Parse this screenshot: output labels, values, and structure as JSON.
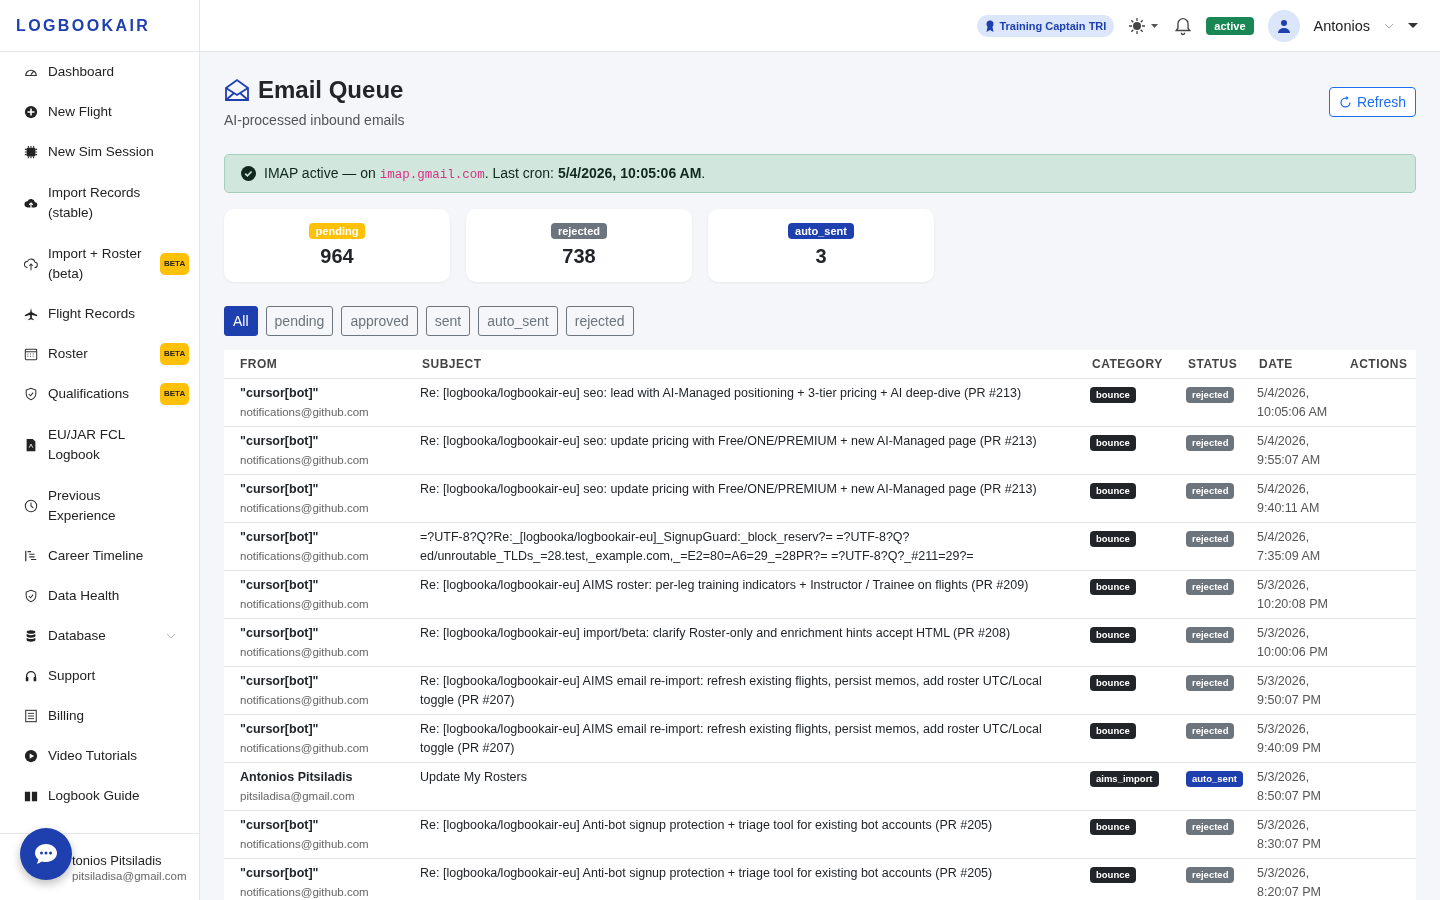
{
  "brand": "LOGBOOKAIR",
  "sidebar": {
    "items": [
      {
        "label": "Dashboard"
      },
      {
        "label": "New Flight"
      },
      {
        "label": "New Sim Session"
      },
      {
        "label": "Import Records (stable)"
      },
      {
        "label": "Import + Roster (beta)",
        "badge": "BETA"
      },
      {
        "label": "Flight Records"
      },
      {
        "label": "Roster",
        "badge": "BETA"
      },
      {
        "label": "Qualifications",
        "badge": "BETA"
      },
      {
        "label": "EU/JAR FCL Logbook"
      },
      {
        "label": "Previous Experience"
      },
      {
        "label": "Career Timeline"
      },
      {
        "label": "Data Health"
      },
      {
        "label": "Database",
        "expanded": false
      },
      {
        "label": "Support"
      },
      {
        "label": "Billing"
      },
      {
        "label": "Video Tutorials"
      },
      {
        "label": "Logbook Guide"
      }
    ],
    "user": {
      "name": "tonios Pitsiladis",
      "email": "pitsiladisa@gmail.com"
    }
  },
  "header": {
    "role": "Training Captain TRI",
    "status": "active",
    "user": "Antonios"
  },
  "page": {
    "title": "Email Queue",
    "subtitle": "AI-processed inbound emails",
    "refresh": "Refresh"
  },
  "alert": {
    "before": "IMAP active — on ",
    "host": "imap.gmail.com",
    "after": ". Last cron: **5/4/2026, 10:05:06 AM**."
  },
  "stats": [
    {
      "label": "pending",
      "value": "964",
      "color": "#ffc107"
    },
    {
      "label": "rejected",
      "value": "738",
      "color": "#6c757d"
    },
    {
      "label": "auto_sent",
      "value": "3",
      "color": "#1e3fae"
    }
  ],
  "filters": [
    {
      "label": "All",
      "selected": true
    },
    {
      "label": "pending",
      "selected": false
    },
    {
      "label": "approved",
      "selected": false
    },
    {
      "label": "sent",
      "selected": false
    },
    {
      "label": "auto_sent",
      "selected": false
    },
    {
      "label": "rejected",
      "selected": false
    }
  ],
  "table": {
    "columns": [
      "FROM",
      "SUBJECT",
      "CATEGORY",
      "STATUS",
      "DATE",
      "ACTIONS"
    ],
    "rows": [
      {
        "from": "\"cursor[bot]\"",
        "email": "notifications@github.com",
        "subject": "Re: [logbooka/logbookair-eu] seo: lead with AI-Managed positioning + 3-tier pricing + AI deep-dive (PR #213)",
        "category": "bounce",
        "status": "rejected",
        "color": "#6c757d",
        "date": "5/4/2026, 10:05:06 AM"
      },
      {
        "from": "\"cursor[bot]\"",
        "email": "notifications@github.com",
        "subject": "Re: [logbooka/logbookair-eu] seo: update pricing with Free/ONE/PREMIUM + new AI-Managed page (PR #213)",
        "category": "bounce",
        "status": "rejected",
        "color": "#6c757d",
        "date": "5/4/2026, 9:55:07 AM"
      },
      {
        "from": "\"cursor[bot]\"",
        "email": "notifications@github.com",
        "subject": "Re: [logbooka/logbookair-eu] seo: update pricing with Free/ONE/PREMIUM + new AI-Managed page (PR #213)",
        "category": "bounce",
        "status": "rejected",
        "color": "#6c757d",
        "date": "5/4/2026, 9:40:11 AM"
      },
      {
        "from": "\"cursor[bot]\"",
        "email": "notifications@github.com",
        "subject": "=?UTF-8?Q?Re:_[logbooka/logbookair-eu]_SignupGuard:_block_reserv?= =?UTF-8?Q? ed/unroutable_TLDs_=28.test,_example.com,_=E2=80=A6=29_=28PR?= =?UTF-8?Q?_#211=29?=",
        "category": "bounce",
        "status": "rejected",
        "color": "#6c757d",
        "date": "5/4/2026, 7:35:09 AM"
      },
      {
        "from": "\"cursor[bot]\"",
        "email": "notifications@github.com",
        "subject": "Re: [logbooka/logbookair-eu] AIMS roster: per-leg training indicators + Instructor / Trainee on flights (PR #209)",
        "category": "bounce",
        "status": "rejected",
        "color": "#6c757d",
        "date": "5/3/2026, 10:20:08 PM"
      },
      {
        "from": "\"cursor[bot]\"",
        "email": "notifications@github.com",
        "subject": "Re: [logbooka/logbookair-eu] import/beta: clarify Roster-only and enrichment hints accept HTML (PR #208)",
        "category": "bounce",
        "status": "rejected",
        "color": "#6c757d",
        "date": "5/3/2026, 10:00:06 PM"
      },
      {
        "from": "\"cursor[bot]\"",
        "email": "notifications@github.com",
        "subject": "Re: [logbooka/logbookair-eu] AIMS email re-import: refresh existing flights, persist memos, add roster UTC/Local toggle (PR #207)",
        "category": "bounce",
        "status": "rejected",
        "color": "#6c757d",
        "date": "5/3/2026, 9:50:07 PM"
      },
      {
        "from": "\"cursor[bot]\"",
        "email": "notifications@github.com",
        "subject": "Re: [logbooka/logbookair-eu] AIMS email re-import: refresh existing flights, persist memos, add roster UTC/Local toggle (PR #207)",
        "category": "bounce",
        "status": "rejected",
        "color": "#6c757d",
        "date": "5/3/2026, 9:40:09 PM"
      },
      {
        "from": "Antonios Pitsiladis",
        "email": "pitsiladisa@gmail.com",
        "subject": "Update My Rosters",
        "category": "aims_import",
        "status": "auto_sent",
        "color": "#1e3fae",
        "date": "5/3/2026, 8:50:07 PM"
      },
      {
        "from": "\"cursor[bot]\"",
        "email": "notifications@github.com",
        "subject": "Re: [logbooka/logbookair-eu] Anti-bot signup protection + triage tool for existing bot accounts (PR #205)",
        "category": "bounce",
        "status": "rejected",
        "color": "#6c757d",
        "date": "5/3/2026, 8:30:07 PM"
      },
      {
        "from": "\"cursor[bot]\"",
        "email": "notifications@github.com",
        "subject": "Re: [logbooka/logbookair-eu] Anti-bot signup protection + triage tool for existing bot accounts (PR #205)",
        "category": "bounce",
        "status": "rejected",
        "color": "#6c757d",
        "date": "5/3/2026, 8:20:07 PM"
      }
    ]
  }
}
